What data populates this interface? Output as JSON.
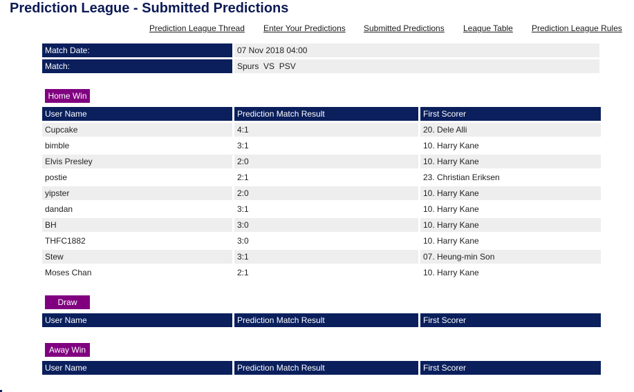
{
  "page": {
    "title": "Prediction League - Submitted Predictions"
  },
  "nav": [
    {
      "label": "Prediction League Thread"
    },
    {
      "label": "Enter Your Predictions"
    },
    {
      "label": "Submitted Predictions"
    },
    {
      "label": "League Table"
    },
    {
      "label": "Prediction League Rules"
    }
  ],
  "match_info": {
    "date_label": "Match Date:",
    "date_value": "07 Nov 2018 04:00",
    "match_label": "Match:",
    "match_value": "Spurs  VS  PSV"
  },
  "columns": {
    "user": "User Name",
    "result": "Prediction Match Result",
    "scorer": "First Scorer"
  },
  "sections": {
    "home": {
      "label": "Home Win",
      "rows": [
        {
          "user": "Cupcake",
          "result": "4:1",
          "scorer": "20. Dele Alli"
        },
        {
          "user": "bimble",
          "result": "3:1",
          "scorer": "10. Harry Kane"
        },
        {
          "user": "Elvis Presley",
          "result": "2:0",
          "scorer": "10. Harry Kane"
        },
        {
          "user": "postie",
          "result": "2:1",
          "scorer": "23. Christian Eriksen"
        },
        {
          "user": "yipster",
          "result": "2:0",
          "scorer": "10. Harry Kane"
        },
        {
          "user": "dandan",
          "result": "3:1",
          "scorer": "10. Harry Kane"
        },
        {
          "user": "BH",
          "result": "3:0",
          "scorer": "10. Harry Kane"
        },
        {
          "user": "THFC1882",
          "result": "3:0",
          "scorer": "10. Harry Kane"
        },
        {
          "user": "Stew",
          "result": "3:1",
          "scorer": "07. Heung-min Son"
        },
        {
          "user": "Moses Chan",
          "result": "2:1",
          "scorer": "10. Harry Kane"
        }
      ]
    },
    "draw": {
      "label": "Draw",
      "rows": []
    },
    "away": {
      "label": "Away Win",
      "rows": []
    }
  },
  "colors": {
    "header_navy": "#0a1f5c",
    "badge_purple": "#800080",
    "row_alt": "#eeeeee"
  }
}
